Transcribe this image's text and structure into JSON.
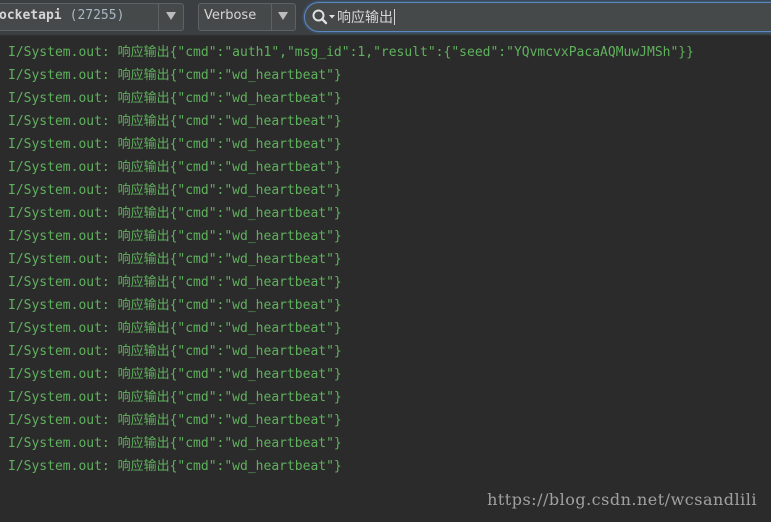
{
  "toolbar": {
    "process_name": "ocketapi",
    "process_pid": "(27255)",
    "log_level": "Verbose",
    "search_value": "响应输出"
  },
  "icons": {
    "process_dropdown": "chevron-down-icon",
    "level_dropdown": "chevron-down-icon",
    "search": "search-icon"
  },
  "colors": {
    "background": "#2b2b2b",
    "toolbar": "#3c3f41",
    "log_text": "#5fb15d",
    "search_focus_border": "#5e86c1"
  },
  "log_lines": [
    "I/System.out: 响应输出{\"cmd\":\"auth1\",\"msg_id\":1,\"result\":{\"seed\":\"YQvmcvxPacaAQMuwJMSh\"}}",
    "I/System.out: 响应输出{\"cmd\":\"wd_heartbeat\"}",
    "I/System.out: 响应输出{\"cmd\":\"wd_heartbeat\"}",
    "I/System.out: 响应输出{\"cmd\":\"wd_heartbeat\"}",
    "I/System.out: 响应输出{\"cmd\":\"wd_heartbeat\"}",
    "I/System.out: 响应输出{\"cmd\":\"wd_heartbeat\"}",
    "I/System.out: 响应输出{\"cmd\":\"wd_heartbeat\"}",
    "I/System.out: 响应输出{\"cmd\":\"wd_heartbeat\"}",
    "I/System.out: 响应输出{\"cmd\":\"wd_heartbeat\"}",
    "I/System.out: 响应输出{\"cmd\":\"wd_heartbeat\"}",
    "I/System.out: 响应输出{\"cmd\":\"wd_heartbeat\"}",
    "I/System.out: 响应输出{\"cmd\":\"wd_heartbeat\"}",
    "I/System.out: 响应输出{\"cmd\":\"wd_heartbeat\"}",
    "I/System.out: 响应输出{\"cmd\":\"wd_heartbeat\"}",
    "I/System.out: 响应输出{\"cmd\":\"wd_heartbeat\"}",
    "I/System.out: 响应输出{\"cmd\":\"wd_heartbeat\"}",
    "I/System.out: 响应输出{\"cmd\":\"wd_heartbeat\"}",
    "I/System.out: 响应输出{\"cmd\":\"wd_heartbeat\"}",
    "I/System.out: 响应输出{\"cmd\":\"wd_heartbeat\"}"
  ],
  "watermark": "https://blog.csdn.net/wcsandlili"
}
